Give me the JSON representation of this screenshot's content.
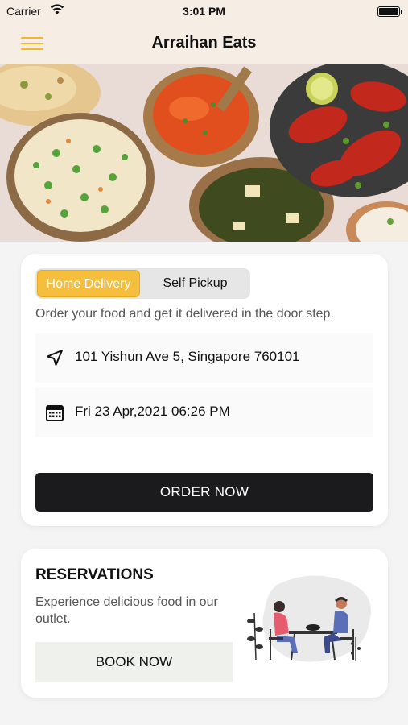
{
  "status_bar": {
    "carrier": "Carrier",
    "time": "3:01 PM"
  },
  "header": {
    "title": "Arraihan Eats",
    "menu_icon": "hamburger-menu-icon",
    "accent": "#f2b92d"
  },
  "hero": {
    "description_icon": "food-dishes-image"
  },
  "order": {
    "tabs": [
      {
        "label": "Home Delivery",
        "active": true
      },
      {
        "label": "Self Pickup",
        "active": false
      }
    ],
    "description": "Order your food and get it delivered in the door step.",
    "address": {
      "icon": "location-arrow-icon",
      "value": "101 Yishun Ave 5, Singapore 760101"
    },
    "datetime": {
      "icon": "calendar-icon",
      "value": "Fri 23 Apr,2021 06:26 PM"
    },
    "button_label": "ORDER NOW"
  },
  "reservations": {
    "title": "RESERVATIONS",
    "description": "Experience delicious food in our outlet.",
    "button_label": "BOOK NOW",
    "illustration": "dining-couple-illustration"
  },
  "colors": {
    "accent": "#f5be3c",
    "dark_button": "#1b1b1d",
    "header_bg": "#f6ede4"
  }
}
